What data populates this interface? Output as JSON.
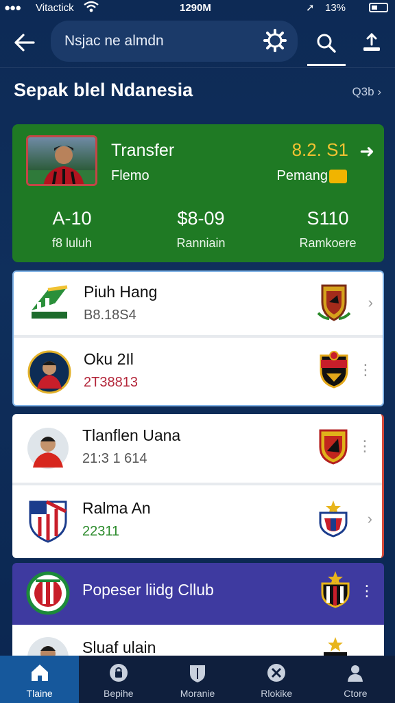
{
  "status_bar": {
    "carrier": "Vitactick",
    "time": "1290M",
    "battery": "13%"
  },
  "header": {
    "search_text": "Nsjac ne almdn"
  },
  "section": {
    "title": "Sepak blel Ndanesia",
    "more": "Q3b"
  },
  "transfer": {
    "title": "Transfer",
    "subtitle": "Flemo",
    "amount": "8.2. S1",
    "status": "Pemang",
    "stats": [
      {
        "value": "A-10",
        "label": "f8 luluh"
      },
      {
        "value": "$8-09",
        "label": "Ranniain"
      },
      {
        "value": "S110",
        "label": "Ramkoere"
      }
    ]
  },
  "list": [
    {
      "name": "Piuh Hang",
      "value": "B8.18S4"
    },
    {
      "name": "Oku 2Il",
      "value": "2T38813"
    },
    {
      "name": "Tlanflen Uana",
      "value": "21:3 1 614"
    },
    {
      "name": "Ralma An",
      "value": "22311"
    }
  ],
  "club": {
    "name": "Popeser liidg Cllub"
  },
  "partial_row": {
    "name": "Sluaf ulain"
  },
  "nav": [
    {
      "label": "Tlaine"
    },
    {
      "label": "Bepihe"
    },
    {
      "label": "Moranie"
    },
    {
      "label": "Rlokike"
    },
    {
      "label": "Ctore"
    }
  ],
  "colors": {
    "background": "#0f2f5c",
    "transfer_card": "#1f7a24",
    "amount": "#f1c232",
    "club_card": "#3e3aa0",
    "nav_active": "#16589c"
  }
}
